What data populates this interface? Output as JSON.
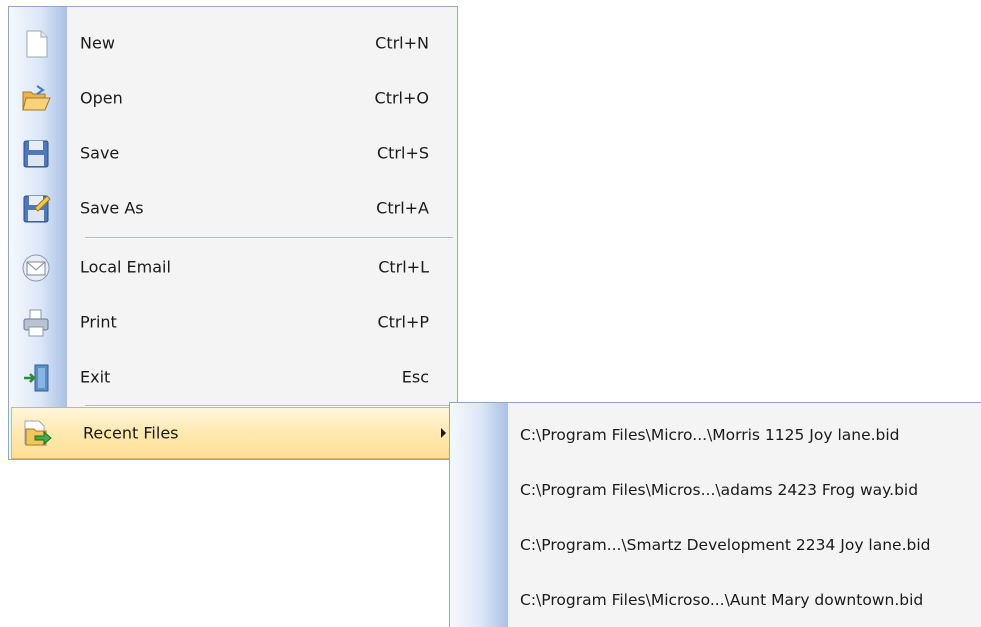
{
  "file_menu": {
    "items": [
      {
        "label": "New",
        "shortcut": "Ctrl+N",
        "icon": "new-document-icon"
      },
      {
        "label": "Open",
        "shortcut": "Ctrl+O",
        "icon": "open-folder-icon"
      },
      {
        "label": "Save",
        "shortcut": "Ctrl+S",
        "icon": "floppy-disk-icon"
      },
      {
        "label": "Save As",
        "shortcut": "Ctrl+A",
        "icon": "save-as-icon"
      },
      {
        "label": "Local Email",
        "shortcut": "Ctrl+L",
        "icon": "envelope-icon"
      },
      {
        "label": "Print",
        "shortcut": "Ctrl+P",
        "icon": "printer-icon"
      },
      {
        "label": "Exit",
        "shortcut": "Esc",
        "icon": "exit-door-icon"
      },
      {
        "label": "Recent Files",
        "icon": "recent-files-icon",
        "has_submenu": true,
        "highlighted": true
      }
    ],
    "highlight_color": "#ffe9b0"
  },
  "recent_files": {
    "items": [
      "C:\\Program Files\\Micro...\\Morris 1125 Joy lane.bid",
      "C:\\Program Files\\Micros...\\adams 2423 Frog way.bid",
      "C:\\Program...\\Smartz Development 2234 Joy lane.bid",
      "C:\\Program Files\\Microso...\\Aunt Mary downtown.bid"
    ]
  }
}
